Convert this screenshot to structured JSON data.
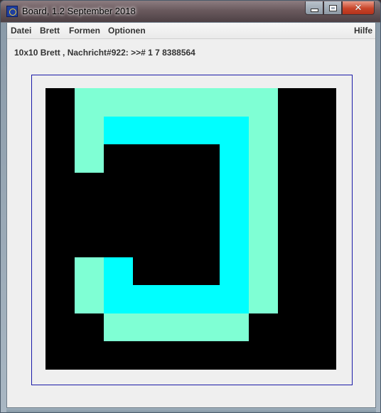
{
  "window": {
    "title": "Board, 1.2 September 2018",
    "icon": "app-icon",
    "controls": [
      "minimize-icon",
      "maximize-icon",
      "close-icon"
    ]
  },
  "menubar": {
    "items": [
      "Datei",
      "Brett",
      "Formen",
      "Optionen"
    ],
    "help": "Hilfe"
  },
  "status_text": "10x10 Brett , Nachricht#922: >># 1 7 8388564",
  "board": {
    "rows": 10,
    "cols": 10,
    "colors": {
      "0": "#000000",
      "1": "#7fffd4",
      "2": "#00ffff"
    },
    "grid": [
      [
        0,
        1,
        1,
        1,
        1,
        1,
        1,
        1,
        0,
        0
      ],
      [
        0,
        1,
        2,
        2,
        2,
        2,
        2,
        1,
        0,
        0
      ],
      [
        0,
        1,
        0,
        0,
        0,
        0,
        2,
        1,
        0,
        0
      ],
      [
        0,
        0,
        0,
        0,
        0,
        0,
        2,
        1,
        0,
        0
      ],
      [
        0,
        0,
        0,
        0,
        0,
        0,
        2,
        1,
        0,
        0
      ],
      [
        0,
        0,
        0,
        0,
        0,
        0,
        2,
        1,
        0,
        0
      ],
      [
        0,
        1,
        2,
        0,
        0,
        0,
        2,
        1,
        0,
        0
      ],
      [
        0,
        1,
        2,
        2,
        2,
        2,
        2,
        1,
        0,
        0
      ],
      [
        0,
        0,
        1,
        1,
        1,
        1,
        1,
        0,
        0,
        0
      ],
      [
        0,
        0,
        0,
        0,
        0,
        0,
        0,
        0,
        0,
        0
      ]
    ]
  }
}
